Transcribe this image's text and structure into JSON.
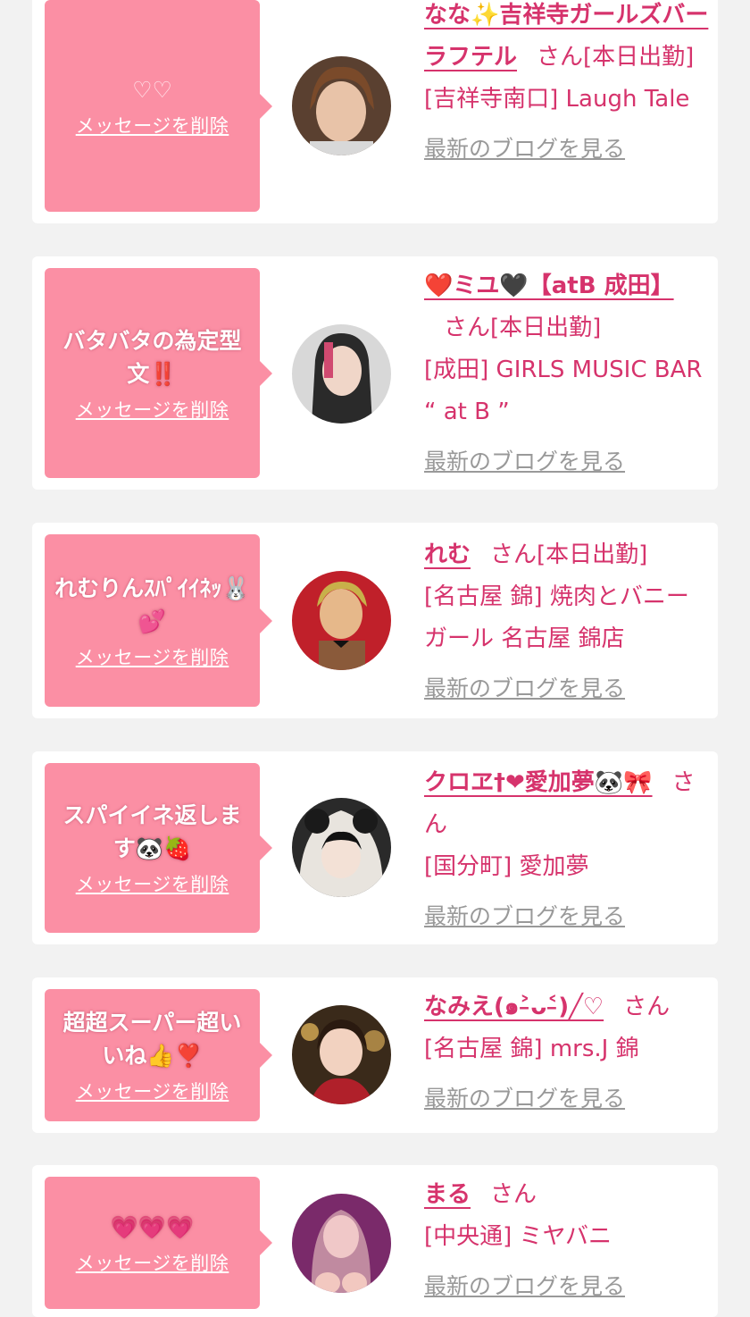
{
  "delete_label": "メッセージを削除",
  "blog_label": "最新のブログを見る",
  "san": "さん",
  "items": [
    {
      "message": "♡♡",
      "name": "なな✨吉祥寺ガールズバーラフテル",
      "status": "[本日出勤]",
      "shop": "[吉祥寺南口] Laugh Tale"
    },
    {
      "message": "バタバタの為定型文‼️",
      "name": "❤️ミユ🖤【atB 成田】",
      "status": "[本日出勤]",
      "shop": "[成田] GIRLS MUSIC BAR “ at B ”"
    },
    {
      "message": "れむりんｽﾊﾟｲｲﾈｯ🐰💕",
      "name": "れむ",
      "status": "[本日出勤]",
      "shop": "[名古屋 錦] 焼肉とバニーガール 名古屋 錦店"
    },
    {
      "message": "スパイイネ返します🐼🍓",
      "name": "クロヱ†❤愛加夢🐼🎀",
      "status": "",
      "shop": "[国分町] 愛加夢"
    },
    {
      "message": "超超スーパー超いいね👍❣️",
      "name": "なみえ(๑˃̵ᴗ˂̵)╱♡",
      "status": "",
      "shop": "[名古屋 錦] mrs.J 錦"
    },
    {
      "message": "💗💗💗",
      "name": "まる",
      "status": "",
      "shop": "[中央通] ミヤバニ"
    }
  ]
}
